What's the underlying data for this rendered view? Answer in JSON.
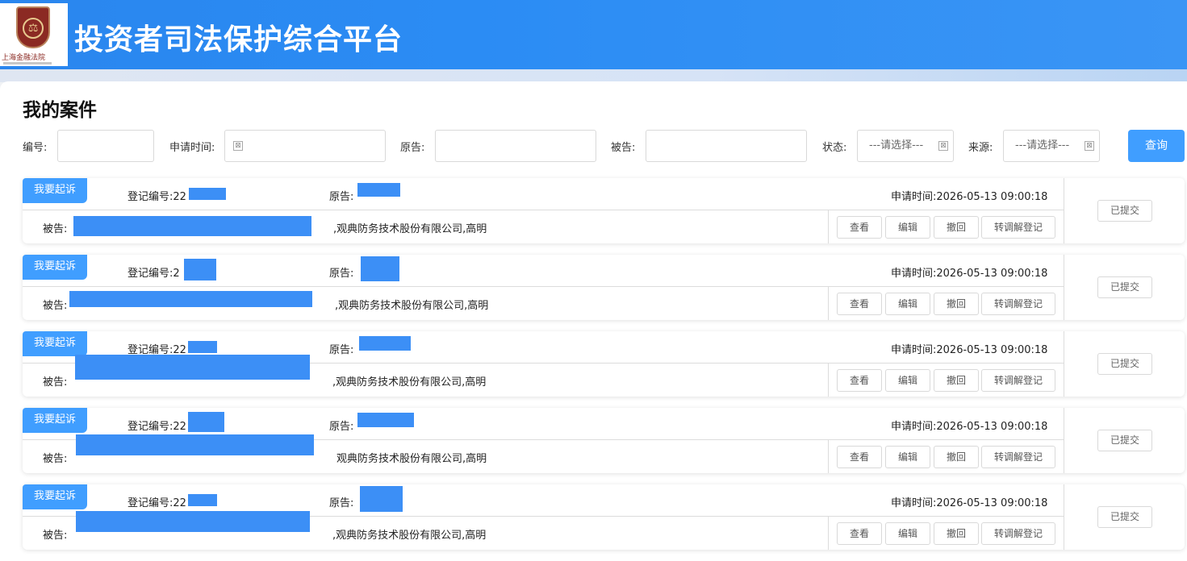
{
  "header": {
    "title": "投资者司法保护综合平台",
    "logo_text": "上海金融法院",
    "logo_glyph": "⚖"
  },
  "page": {
    "title": "我的案件"
  },
  "filters": {
    "number_label": "编号:",
    "apply_time_label": "申请时间:",
    "plaintiff_label": "原告:",
    "defendant_label": "被告:",
    "status_label": "状态:",
    "status_value": "---请选择---",
    "source_label": "来源:",
    "source_value": "---请选择---",
    "date_icon": "⊠",
    "query_label": "查询"
  },
  "case_labels": {
    "tag": "我要起诉",
    "reg_no": "登记编号:",
    "plaintiff": "原告:",
    "defendant": "被告:",
    "view": "查看",
    "edit": "编辑",
    "withdraw": "撤回",
    "mediation": "转调解登记",
    "status": "已提交"
  },
  "cases": [
    {
      "reg_prefix": "22",
      "time": "申请时间:2026-05-13 09:00:18",
      "defendant_suffix": ",观典防务技术股份有限公司,高明"
    },
    {
      "reg_prefix": "2",
      "time": "申请时间:2026-05-13 09:00:18",
      "defendant_suffix": ",观典防务技术股份有限公司,高明"
    },
    {
      "reg_prefix": "22",
      "time": "申请时间:2026-05-13 09:00:18",
      "defendant_suffix": ",观典防务技术股份有限公司,高明"
    },
    {
      "reg_prefix": "22",
      "time": "申请时间:2026-05-13 09:00:18",
      "defendant_suffix": "观典防务技术股份有限公司,高明"
    },
    {
      "reg_prefix": "22",
      "time": "申请时间:2026-05-13 09:00:18",
      "defendant_suffix": ",观典防务技术股份有限公司,高明"
    }
  ]
}
